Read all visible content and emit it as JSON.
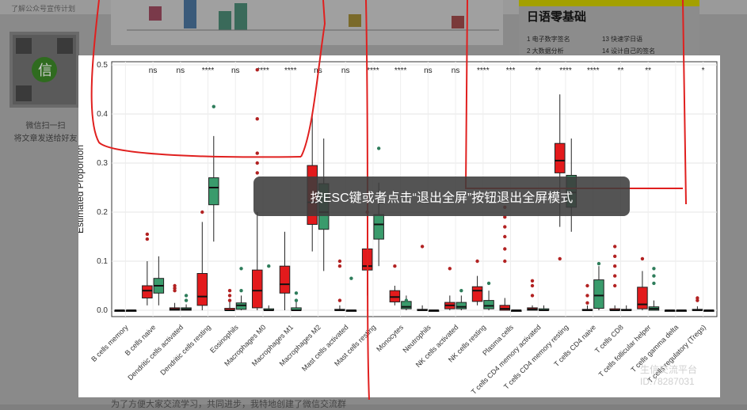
{
  "page": {
    "top_note": "了解公众号宣传计划",
    "qr_caption_1": "微信扫一扫",
    "qr_caption_2": "将文章发送给好友",
    "sidebar_title": "日语零基础",
    "sidebar_items": [
      "1 电子数字签名",
      "13 快速学日语",
      "2 大数据分析",
      "14 设计自己的签名"
    ],
    "bottom_text": "为了方便大家交流学习，共同进步，我特地创建了微信交流群",
    "overlay_text": "按ESC键或者点击“退出全屏”按钮退出全屏模式",
    "watermark_1": "生信交流平台",
    "watermark_2": "ID:78287031",
    "colors": {
      "red": "#e31a1c",
      "green": "#3a9b6c",
      "annot": "#e0201f"
    }
  },
  "chart_data": {
    "type": "boxplot",
    "ylabel": "Estimated Proportion",
    "ylim": [
      0,
      0.5
    ],
    "yticks": [
      "0.0",
      "0.1",
      "0.2",
      "0.3",
      "0.4",
      "0.5"
    ],
    "categories": [
      "B cells memory",
      "B cells naive",
      "Dendritic cells activated",
      "Dendritic cells resting",
      "Eosinophils",
      "Macrophages M0",
      "Macrophages M1",
      "Macrophages M2",
      "Mast cells activated",
      "Mast cells resting",
      "Monocytes",
      "Neutrophils",
      "NK cells activated",
      "NK cells resting",
      "Plasma cells",
      "T cells CD4 memory activated",
      "T cells CD4 memory resting",
      "T cells CD4 naive",
      "T cells CD8",
      "T cells follicular helper",
      "T cells gamma delta",
      "T cells regulatory (Tregs)"
    ],
    "significance": [
      "",
      "ns",
      "ns",
      "****",
      "ns",
      "****",
      "****",
      "ns",
      "ns",
      "****",
      "****",
      "ns",
      "ns",
      "****",
      "***",
      "**",
      "****",
      "****",
      "**",
      "**",
      "",
      "*"
    ],
    "series": [
      {
        "name": "red",
        "boxes": [
          [
            0,
            0,
            0,
            0,
            0
          ],
          [
            0.01,
            0.025,
            0.04,
            0.05,
            0.1
          ],
          [
            0,
            0,
            0.002,
            0.005,
            0.015
          ],
          [
            0,
            0.01,
            0.028,
            0.075,
            0.18
          ],
          [
            0,
            0,
            0,
            0.004,
            0.02
          ],
          [
            0,
            0.005,
            0.04,
            0.082,
            0.2
          ],
          [
            0,
            0.035,
            0.053,
            0.09,
            0.16
          ],
          [
            0.12,
            0.175,
            0.22,
            0.295,
            0.4
          ],
          [
            0,
            0,
            0,
            0.002,
            0.01
          ],
          [
            0.03,
            0.082,
            0.09,
            0.125,
            0.16
          ],
          [
            0.01,
            0.017,
            0.027,
            0.04,
            0.05
          ],
          [
            0,
            0,
            0,
            0.002,
            0.01
          ],
          [
            0,
            0.003,
            0.01,
            0.016,
            0.03
          ],
          [
            0.01,
            0.018,
            0.04,
            0.048,
            0.07
          ],
          [
            0,
            0,
            0.003,
            0.01,
            0.025
          ],
          [
            0,
            0,
            0.002,
            0.005,
            0.01
          ],
          [
            0.17,
            0.28,
            0.305,
            0.34,
            0.44
          ],
          [
            0,
            0,
            0,
            0.002,
            0.01
          ],
          [
            0,
            0,
            0,
            0.003,
            0.01
          ],
          [
            0,
            0.003,
            0.012,
            0.047,
            0.08
          ],
          [
            0,
            0,
            0,
            0,
            0
          ],
          [
            0,
            0,
            0,
            0.002,
            0.008
          ]
        ]
      },
      {
        "name": "green",
        "boxes": [
          [
            0,
            0,
            0,
            0,
            0
          ],
          [
            0.01,
            0.035,
            0.05,
            0.065,
            0.11
          ],
          [
            0,
            0,
            0.002,
            0.005,
            0.012
          ],
          [
            0.14,
            0.215,
            0.25,
            0.27,
            0.355
          ],
          [
            0,
            0.002,
            0.01,
            0.015,
            0.03
          ],
          [
            0,
            0,
            0,
            0.003,
            0.01
          ],
          [
            0,
            0,
            0,
            0.005,
            0.02
          ],
          [
            0.08,
            0.165,
            0.2,
            0.258,
            0.35
          ],
          [
            0,
            0,
            0,
            0,
            0
          ],
          [
            0.09,
            0.145,
            0.175,
            0.195,
            0.26
          ],
          [
            0,
            0.003,
            0.007,
            0.018,
            0.03
          ],
          [
            0,
            0,
            0,
            0,
            0
          ],
          [
            0,
            0.003,
            0.007,
            0.016,
            0.03
          ],
          [
            0,
            0.003,
            0.009,
            0.02,
            0.04
          ],
          [
            0,
            0,
            0,
            0,
            0
          ],
          [
            0,
            0,
            0,
            0.003,
            0.01
          ],
          [
            0.16,
            0.21,
            0.24,
            0.275,
            0.35
          ],
          [
            0,
            0.004,
            0.03,
            0.062,
            0.09
          ],
          [
            0,
            0,
            0,
            0.002,
            0.01
          ],
          [
            0,
            0,
            0.003,
            0.007,
            0.02
          ],
          [
            0,
            0,
            0,
            0,
            0
          ],
          [
            0,
            0,
            0,
            0,
            0
          ]
        ]
      }
    ],
    "outliers": {
      "red": [
        [
          1,
          0.155
        ],
        [
          1,
          0.145
        ],
        [
          2,
          0.05
        ],
        [
          2,
          0.045
        ],
        [
          2,
          0.04
        ],
        [
          3,
          0.2
        ],
        [
          4,
          0.04
        ],
        [
          4,
          0.03
        ],
        [
          4,
          0.02
        ],
        [
          5,
          0.49
        ],
        [
          5,
          0.39
        ],
        [
          5,
          0.32
        ],
        [
          5,
          0.3
        ],
        [
          5,
          0.28
        ],
        [
          8,
          0.1
        ],
        [
          8,
          0.09
        ],
        [
          8,
          0.02
        ],
        [
          9,
          0.2
        ],
        [
          10,
          0.09
        ],
        [
          11,
          0.13
        ],
        [
          12,
          0.085
        ],
        [
          13,
          0.1
        ],
        [
          14,
          0.21
        ],
        [
          14,
          0.19
        ],
        [
          14,
          0.17
        ],
        [
          14,
          0.15
        ],
        [
          14,
          0.125
        ],
        [
          14,
          0.1
        ],
        [
          15,
          0.06
        ],
        [
          15,
          0.05
        ],
        [
          15,
          0.03
        ],
        [
          16,
          0.105
        ],
        [
          17,
          0.05
        ],
        [
          17,
          0.03
        ],
        [
          17,
          0.015
        ],
        [
          18,
          0.13
        ],
        [
          18,
          0.11
        ],
        [
          18,
          0.09
        ],
        [
          18,
          0.07
        ],
        [
          18,
          0.05
        ],
        [
          19,
          0.105
        ],
        [
          21,
          0.025
        ],
        [
          21,
          0.02
        ]
      ],
      "green": [
        [
          2,
          0.03
        ],
        [
          2,
          0.02
        ],
        [
          3,
          0.415
        ],
        [
          4,
          0.085
        ],
        [
          4,
          0.04
        ],
        [
          5,
          0.09
        ],
        [
          6,
          0.035
        ],
        [
          6,
          0.02
        ],
        [
          8,
          0.065
        ],
        [
          9,
          0.33
        ],
        [
          10,
          0.02
        ],
        [
          12,
          0.04
        ],
        [
          13,
          0.055
        ],
        [
          17,
          0.095
        ],
        [
          19,
          0.085
        ],
        [
          19,
          0.07
        ],
        [
          19,
          0.055
        ]
      ]
    }
  }
}
